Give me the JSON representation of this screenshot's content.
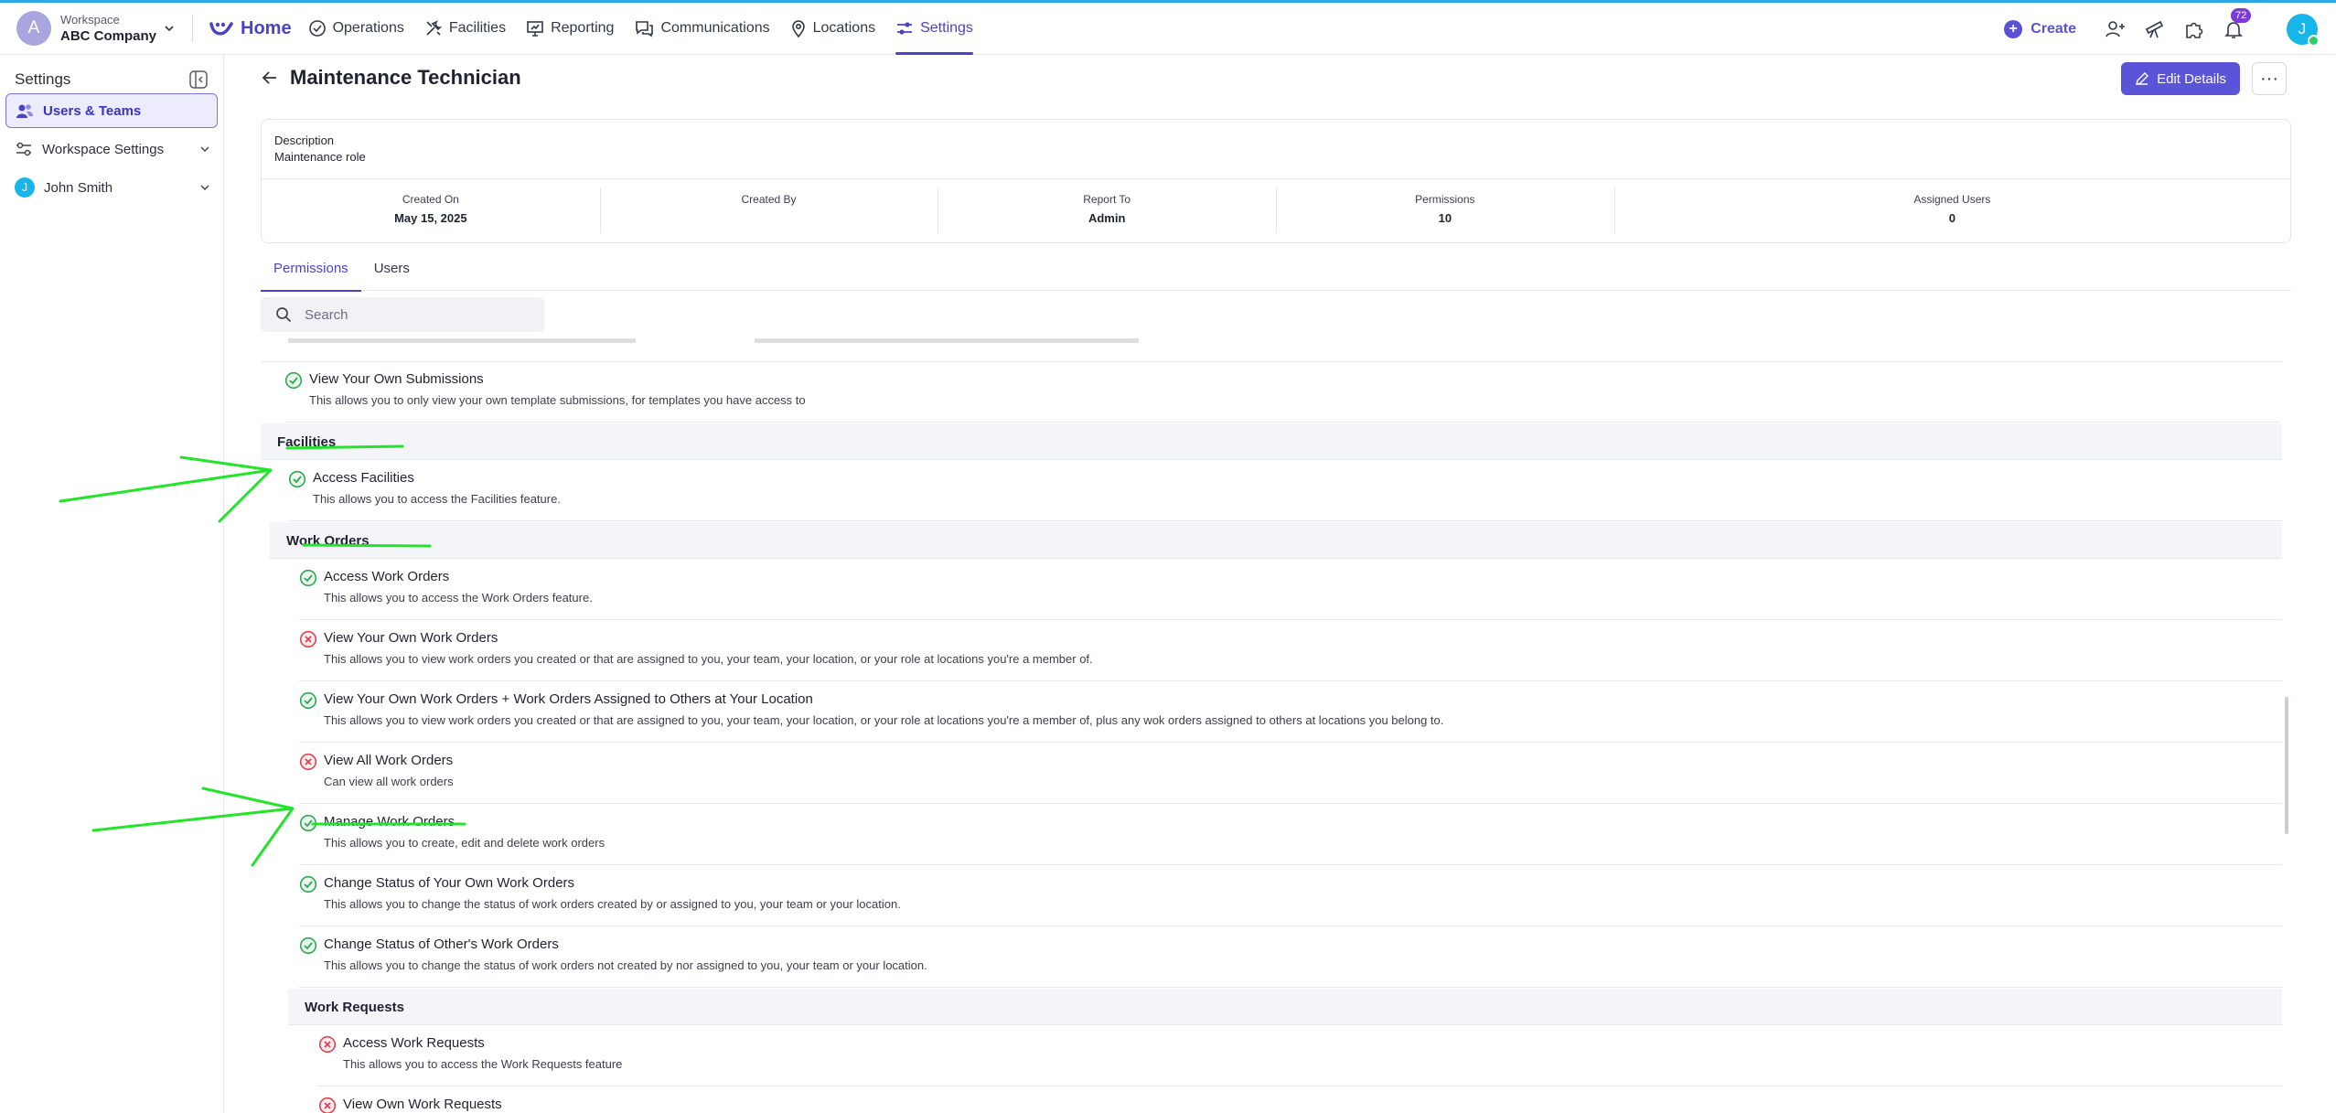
{
  "workspace": {
    "label": "Workspace",
    "name": "ABC Company",
    "avatar_letter": "A"
  },
  "nav": {
    "home": "Home",
    "items": [
      "Operations",
      "Facilities",
      "Reporting",
      "Communications",
      "Locations",
      "Settings"
    ],
    "active": "Settings",
    "create": "Create",
    "notification_count": "72",
    "user_letter": "J"
  },
  "sidebar": {
    "title": "Settings",
    "items": [
      {
        "label": "Users & Teams",
        "icon": "users-icon",
        "active": true
      },
      {
        "label": "Workspace Settings",
        "icon": "sliders-icon",
        "active": false
      },
      {
        "label": "John Smith",
        "icon": "avatar",
        "avatar_letter": "J",
        "active": false
      }
    ]
  },
  "page": {
    "title": "Maintenance Technician",
    "edit_button": "Edit Details",
    "more_button": "···"
  },
  "details": {
    "description_label": "Description",
    "description_value": "Maintenance role",
    "stats": [
      {
        "label": "Created On",
        "value": "May 15, 2025"
      },
      {
        "label": "Created By",
        "value": ""
      },
      {
        "label": "Report To",
        "value": "Admin"
      },
      {
        "label": "Permissions",
        "value": "10"
      },
      {
        "label": "Assigned Users",
        "value": "0"
      }
    ]
  },
  "tabs": {
    "items": [
      "Permissions",
      "Users"
    ],
    "active": "Permissions"
  },
  "search": {
    "placeholder": "Search"
  },
  "permissions": {
    "rows": [
      {
        "title": "View Your Own Submissions",
        "desc": "This allows you to only view your own template submissions, for templates you have access to",
        "granted": true
      },
      {
        "section": "Facilities"
      },
      {
        "title": "Access Facilities",
        "desc": "This allows you to access the Facilities feature.",
        "granted": true
      },
      {
        "section": "Work Orders"
      },
      {
        "title": "Access Work Orders",
        "desc": "This allows you to access the Work Orders feature.",
        "granted": true
      },
      {
        "title": "View Your Own Work Orders",
        "desc": "This allows you to view work orders you created or that are assigned to you, your team, your location, or your role at locations you're a member of.",
        "granted": false
      },
      {
        "title": "View Your Own Work Orders + Work Orders Assigned to Others at Your Location",
        "desc": "This allows you to view work orders you created or that are assigned to you, your team, your location, or your role at locations you're a member of, plus any wok orders assigned to others at locations you belong to.",
        "granted": true
      },
      {
        "title": "View All Work Orders",
        "desc": "Can view all work orders",
        "granted": false
      },
      {
        "title": "Manage Work Orders",
        "desc": "This allows you to create, edit and delete work orders",
        "granted": true
      },
      {
        "title": "Change Status of Your Own Work Orders",
        "desc": "This allows you to change the status of work orders created by or assigned to you, your team or your location.",
        "granted": true
      },
      {
        "title": "Change Status of Other's Work Orders",
        "desc": "This allows you to change the status of work orders not created by nor assigned to you, your team or your location.",
        "granted": true
      },
      {
        "section": "Work Requests"
      },
      {
        "title": "Access Work Requests",
        "desc": "This allows you to access the Work Requests feature",
        "granted": false
      },
      {
        "title": "View Own Work Requests",
        "desc": "",
        "granted": false
      }
    ]
  },
  "colors": {
    "accent": "#4a43c9",
    "granted": "#2fa84f",
    "denied": "#e0434f",
    "annotation": "#22e52b"
  }
}
